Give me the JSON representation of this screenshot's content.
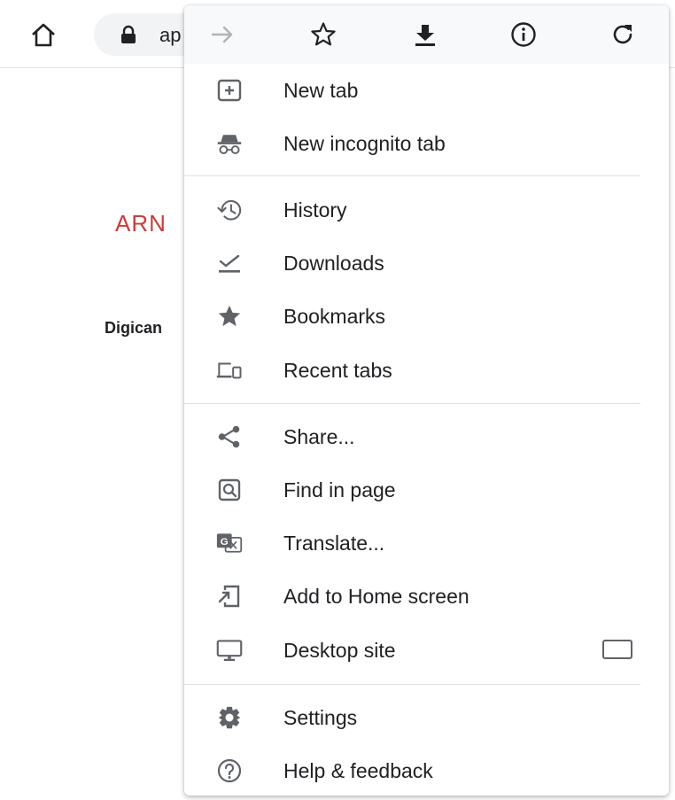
{
  "toolbar": {
    "url_text": "ap"
  },
  "page": {
    "brand_text": "ARN",
    "subtext": "Digican"
  },
  "menu": {
    "actions": [
      {
        "name": "forward",
        "icon": "arrow-right-icon",
        "enabled": false
      },
      {
        "name": "bookmark",
        "icon": "star-outline-icon",
        "enabled": true
      },
      {
        "name": "download",
        "icon": "download-icon",
        "enabled": true
      },
      {
        "name": "page-info",
        "icon": "info-icon",
        "enabled": true
      },
      {
        "name": "reload",
        "icon": "refresh-icon",
        "enabled": true
      }
    ],
    "items": {
      "new_tab": "New tab",
      "new_incognito_tab": "New incognito tab",
      "history": "History",
      "downloads": "Downloads",
      "bookmarks": "Bookmarks",
      "recent_tabs": "Recent tabs",
      "share": "Share...",
      "find_in_page": "Find in page",
      "translate": "Translate...",
      "add_to_home_screen": "Add to Home screen",
      "desktop_site": "Desktop site",
      "settings": "Settings",
      "help_feedback": "Help & feedback"
    },
    "desktop_site_checked": false
  },
  "colors": {
    "icon": "#5f6368",
    "icon_disabled": "#b0b3b8",
    "text": "#202124",
    "brand": "#d03a36",
    "action_bar_bg": "#f8f9fa"
  }
}
